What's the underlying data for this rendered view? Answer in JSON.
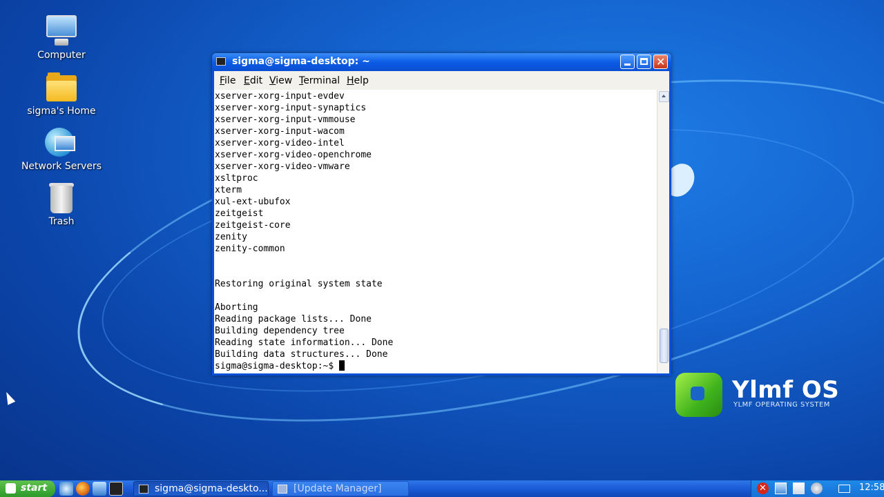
{
  "desktop": {
    "icons": [
      {
        "label": "Computer"
      },
      {
        "label": "sigma's Home"
      },
      {
        "label": "Network Servers"
      },
      {
        "label": "Trash"
      }
    ],
    "logo_text": "Ylmf OS",
    "logo_subtitle": "YLMF OPERATING SYSTEM"
  },
  "window": {
    "title": "sigma@sigma-desktop: ~",
    "menu": [
      "File",
      "Edit",
      "View",
      "Terminal",
      "Help"
    ],
    "lines": [
      "xserver-xorg-input-evdev",
      "xserver-xorg-input-synaptics",
      "xserver-xorg-input-vmmouse",
      "xserver-xorg-input-wacom",
      "xserver-xorg-video-intel",
      "xserver-xorg-video-openchrome",
      "xserver-xorg-video-vmware",
      "xsltproc",
      "xterm",
      "xul-ext-ubufox",
      "zeitgeist",
      "zeitgeist-core",
      "zenity",
      "zenity-common",
      "",
      "",
      "Restoring original system state",
      "",
      "Aborting",
      "Reading package lists... Done",
      "Building dependency tree",
      "Reading state information... Done",
      "Building data structures... Done",
      "sigma@sigma-desktop:~$ "
    ]
  },
  "taskbar": {
    "start_label": "start",
    "tasks": [
      {
        "label": "sigma@sigma-deskto..."
      },
      {
        "label": "[Update Manager]"
      }
    ],
    "clock": "12:58"
  }
}
